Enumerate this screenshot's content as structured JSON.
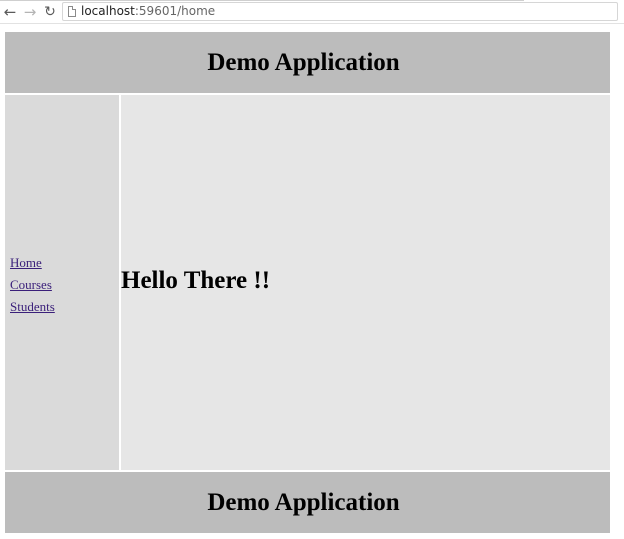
{
  "browser": {
    "back_icon": "←",
    "forward_icon": "→",
    "reload_icon": "↻",
    "url_host": "localhost",
    "url_rest": ":59601/home"
  },
  "header": {
    "title": "Demo Application"
  },
  "sidebar": {
    "items": [
      {
        "label": "Home"
      },
      {
        "label": "Courses"
      },
      {
        "label": "Students"
      }
    ]
  },
  "main": {
    "heading": "Hello There !!"
  },
  "footer": {
    "title": "Demo Application"
  },
  "colors": {
    "header_bg": "#bcbcbc",
    "sidebar_bg": "#dadada",
    "main_bg": "#e6e6e6",
    "link": "#3a1f7a"
  }
}
